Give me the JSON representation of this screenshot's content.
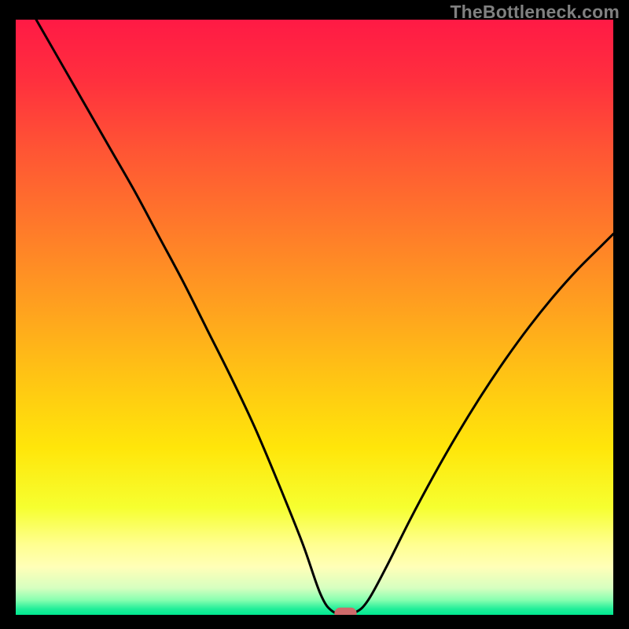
{
  "watermark": "TheBottleneck.com",
  "colors": {
    "bg": "#000000",
    "curve": "#000000",
    "marker_fill": "#cf6a6b",
    "marker_stroke": "#cf6a6b",
    "gradient_stops": [
      {
        "offset": 0.0,
        "color": "#ff1a45"
      },
      {
        "offset": 0.1,
        "color": "#ff2f3e"
      },
      {
        "offset": 0.22,
        "color": "#ff5534"
      },
      {
        "offset": 0.35,
        "color": "#ff7a2a"
      },
      {
        "offset": 0.48,
        "color": "#ffa01f"
      },
      {
        "offset": 0.6,
        "color": "#ffc414"
      },
      {
        "offset": 0.72,
        "color": "#ffe60a"
      },
      {
        "offset": 0.82,
        "color": "#f6ff30"
      },
      {
        "offset": 0.88,
        "color": "#ffff8e"
      },
      {
        "offset": 0.92,
        "color": "#ffffb8"
      },
      {
        "offset": 0.955,
        "color": "#d6ffc0"
      },
      {
        "offset": 0.975,
        "color": "#88ffb0"
      },
      {
        "offset": 0.99,
        "color": "#22ee99"
      },
      {
        "offset": 1.0,
        "color": "#00e890"
      }
    ]
  },
  "chart_data": {
    "type": "line",
    "title": "",
    "xlabel": "",
    "ylabel": "",
    "xlim": [
      0,
      100
    ],
    "ylim": [
      0,
      100
    ],
    "x": [
      0,
      4,
      8,
      12,
      16,
      20,
      24,
      28,
      32,
      36,
      40,
      44,
      48,
      51,
      53,
      55,
      57,
      59,
      62,
      66,
      70,
      74,
      78,
      82,
      86,
      90,
      94,
      98,
      100
    ],
    "values": [
      106,
      99,
      92,
      85,
      78,
      71,
      63.5,
      56,
      48,
      40,
      31.5,
      22,
      12,
      3.5,
      0.6,
      0.3,
      0.5,
      2.5,
      8,
      16,
      23.5,
      30.5,
      37,
      43,
      48.5,
      53.5,
      58,
      62,
      64
    ],
    "marker": {
      "x": 55.2,
      "y": 0.25,
      "rx": 1.8,
      "ry": 0.9
    }
  }
}
